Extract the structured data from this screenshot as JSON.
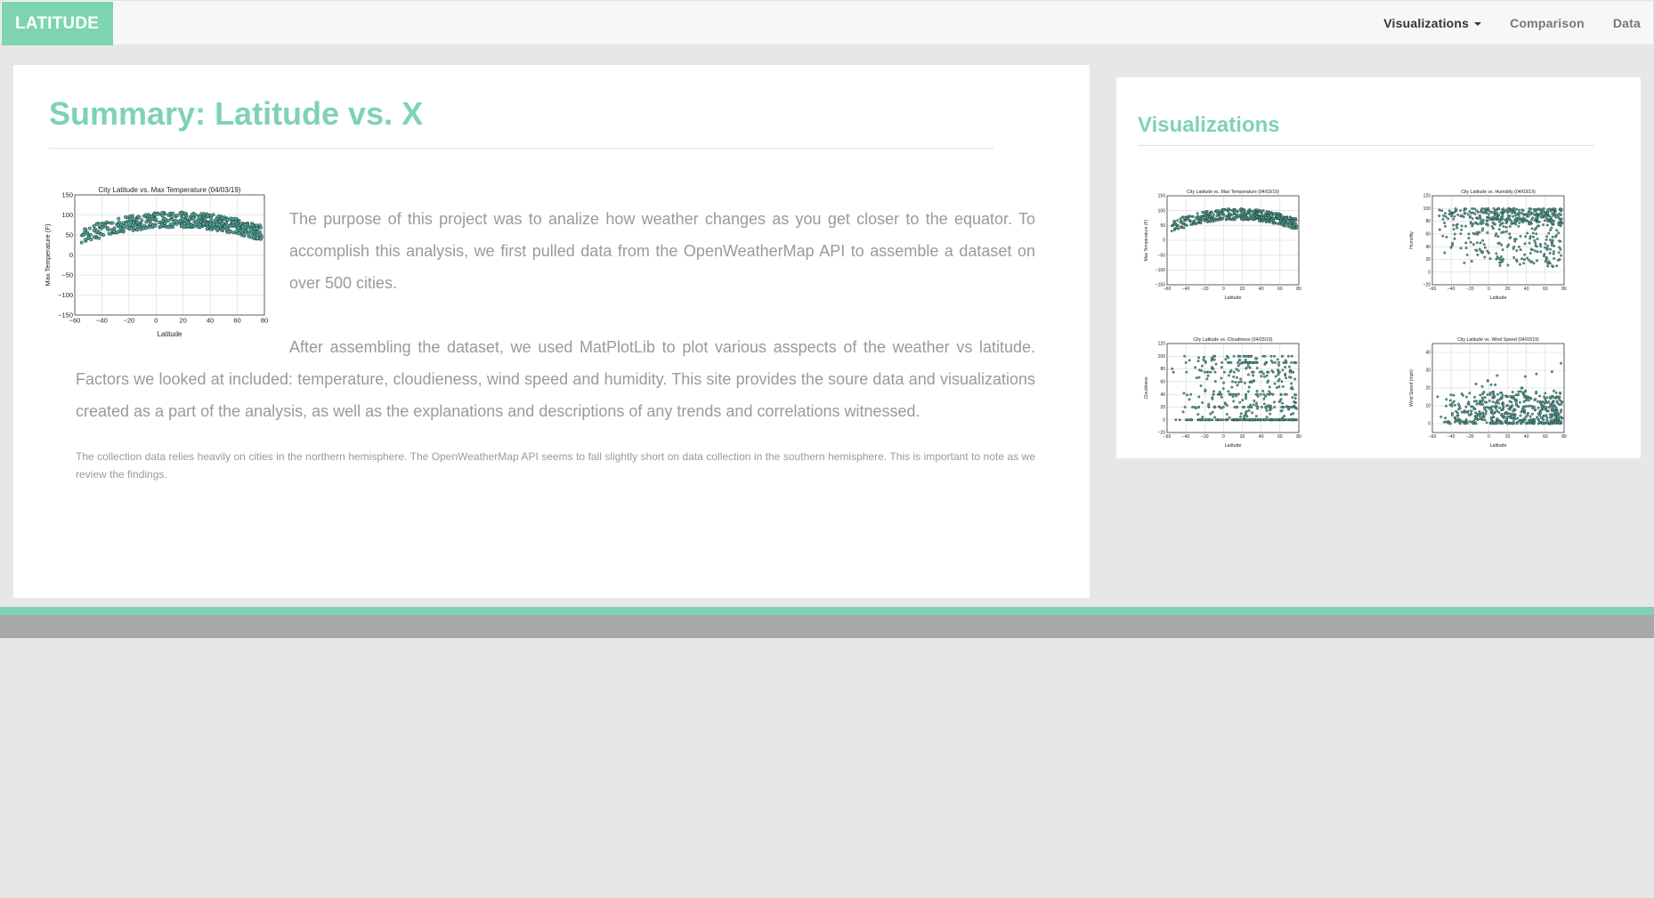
{
  "navbar": {
    "brand": "LATITUDE",
    "links": [
      {
        "label": "Visualizations",
        "active": true,
        "dropdown": true
      },
      {
        "label": "Comparison",
        "active": false
      },
      {
        "label": "Data",
        "active": false
      }
    ]
  },
  "main": {
    "title": "Summary: Latitude vs. X",
    "paragraph1": "The purpose of this project was to analize how weather changes as you get closer to the equator. To accomplish this analysis, we first pulled data from the OpenWeatherMap API to assemble a dataset on over 500 cities.",
    "paragraph2": "After assembling the dataset, we used MatPlotLib to plot various asspects of the weather vs latitude. Factors we looked at included: temperature, cloudieness, wind speed and humidity. This site provides the soure data and visualizations created as a part of the analysis, as well as the explanations and descriptions of any trends and correlations witnessed.",
    "note": "The collection data relies heavily on cities in the northern hemisphere. The OpenWeatherMap API seems to fall slightly short on data collection in the southern hemisphere. This is important to note as we review the findings."
  },
  "sidebar": {
    "title": "Visualizations"
  },
  "colors": {
    "accent": "#7ed3b1",
    "marker": "#3d8a8c",
    "text_muted": "#9a9a9a"
  },
  "chart_data": [
    {
      "id": "temperature",
      "type": "scatter",
      "title": "City Latitude vs. Max Temperature (04/03/19)",
      "xlabel": "Latitude",
      "ylabel": "Max Temperature (F)",
      "xlim": [
        -60,
        80
      ],
      "ylim": [
        -150,
        150
      ],
      "xticks": [
        -60,
        -40,
        -20,
        0,
        20,
        40,
        60,
        80
      ],
      "yticks": [
        -150,
        -100,
        -50,
        0,
        50,
        100,
        150
      ],
      "xtick_labels": [
        "−60",
        "−40",
        "−20",
        "0",
        "20",
        "40",
        "60",
        "80"
      ],
      "ytick_labels": [
        "−150",
        "−100",
        "−50",
        "0",
        "50",
        "100",
        "150"
      ],
      "pattern": "arc",
      "grid": true
    },
    {
      "id": "humidity",
      "type": "scatter",
      "title": "City Latitude vs. Humidity (04/03/19)",
      "xlabel": "Latitude",
      "ylabel": "Humidity",
      "xlim": [
        -60,
        80
      ],
      "ylim": [
        -20,
        120
      ],
      "xticks": [
        -60,
        -40,
        -20,
        0,
        20,
        40,
        60,
        80
      ],
      "yticks": [
        -20,
        0,
        20,
        40,
        60,
        80,
        100,
        120
      ],
      "xtick_labels": [
        "−60",
        "−40",
        "−20",
        "0",
        "20",
        "40",
        "60",
        "80"
      ],
      "ytick_labels": [
        "−20",
        "0",
        "20",
        "40",
        "60",
        "80",
        "100",
        "120"
      ],
      "pattern": "humidity",
      "grid": true
    },
    {
      "id": "cloudiness",
      "type": "scatter",
      "title": "City Latitude vs. Cloudiness (04/03/19)",
      "xlabel": "Latitude",
      "ylabel": "Cloudiness",
      "xlim": [
        -60,
        80
      ],
      "ylim": [
        -20,
        120
      ],
      "xticks": [
        -60,
        -40,
        -20,
        0,
        20,
        40,
        60,
        80
      ],
      "yticks": [
        -20,
        0,
        20,
        40,
        60,
        80,
        100,
        120
      ],
      "xtick_labels": [
        "−60",
        "−40",
        "−20",
        "0",
        "20",
        "40",
        "60",
        "80"
      ],
      "ytick_labels": [
        "−20",
        "0",
        "20",
        "40",
        "60",
        "80",
        "100",
        "120"
      ],
      "pattern": "cloudiness",
      "grid": true
    },
    {
      "id": "wind",
      "type": "scatter",
      "title": "City Latitude vs. Wind Speed (04/03/19)",
      "xlabel": "Latitude",
      "ylabel": "Wind Speed (mph)",
      "xlim": [
        -60,
        80
      ],
      "ylim": [
        -5,
        45
      ],
      "xticks": [
        -60,
        -40,
        -20,
        0,
        20,
        40,
        60,
        80
      ],
      "yticks": [
        0,
        10,
        20,
        30,
        40
      ],
      "xtick_labels": [
        "−60",
        "−40",
        "−20",
        "0",
        "20",
        "40",
        "60",
        "80"
      ],
      "ytick_labels": [
        "0",
        "10",
        "20",
        "30",
        "40"
      ],
      "pattern": "wind",
      "grid": true
    }
  ]
}
